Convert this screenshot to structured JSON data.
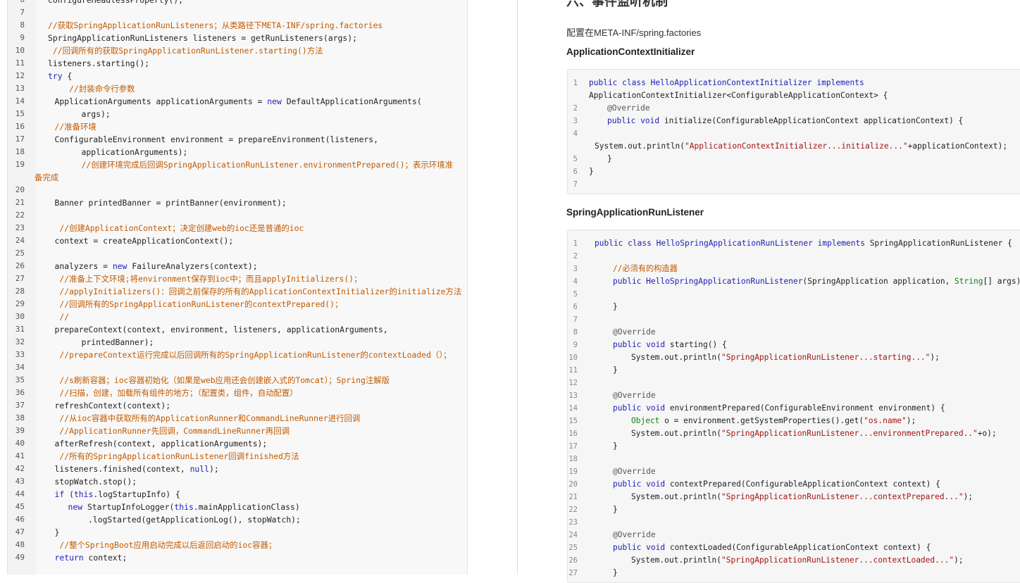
{
  "left_editor": {
    "lines": [
      {
        "n": "6",
        "t": "configureHeadlessProperty();",
        "c": "",
        "i": 2
      },
      {
        "n": "7",
        "t": "",
        "c": "",
        "i": 2
      },
      {
        "n": "8",
        "t": "//获取SpringApplicationRunListeners；从类路径下META-INF/spring.factories",
        "c": "cm",
        "i": 2
      },
      {
        "n": "9",
        "t": "SpringApplicationRunListeners listeners = getRunListeners(args);",
        "c": "",
        "i": 2
      },
      {
        "n": "10",
        "t": " //回调所有的获取SpringApplicationRunListener.starting()方法",
        "c": "cm",
        "i": 2
      },
      {
        "n": "11",
        "t": "listeners.starting();",
        "c": "",
        "i": 2
      },
      {
        "n": "12",
        "t": "try {",
        "c": "kw",
        "i": 2
      },
      {
        "n": "13",
        "t": "   //封装命令行参数",
        "c": "cm",
        "i": 3
      },
      {
        "n": "14",
        "t": "ApplicationArguments applicationArguments = new DefaultApplicationArguments(",
        "c": "",
        "i": 3
      },
      {
        "n": "15",
        "t": "args);",
        "c": "",
        "i": 7
      },
      {
        "n": "16",
        "t": "//准备环境",
        "c": "cm",
        "i": 3
      },
      {
        "n": "17",
        "t": "ConfigurableEnvironment environment = prepareEnvironment(listeners,",
        "c": "",
        "i": 3
      },
      {
        "n": "18",
        "t": "applicationArguments);",
        "c": "",
        "i": 7
      },
      {
        "n": "19",
        "t": "//创建环境完成后回调SpringApplicationRunListener.environmentPrepared()；表示环境准",
        "c": "cm",
        "i": 7
      },
      {
        "n": "",
        "t": "备完成",
        "c": "cm",
        "i": 0
      },
      {
        "n": "20",
        "t": "",
        "c": "",
        "i": 2
      },
      {
        "n": "21",
        "t": "Banner printedBanner = printBanner(environment);",
        "c": "",
        "i": 3
      },
      {
        "n": "22",
        "t": "",
        "c": "",
        "i": 2
      },
      {
        "n": "23",
        "t": " //创建ApplicationContext；决定创建web的ioc还是普通的ioc",
        "c": "cm",
        "i": 3
      },
      {
        "n": "24",
        "t": "context = createApplicationContext();",
        "c": "",
        "i": 3
      },
      {
        "n": "25",
        "t": "",
        "c": "",
        "i": 2
      },
      {
        "n": "26",
        "t": "analyzers = new FailureAnalyzers(context);",
        "c": "",
        "i": 3
      },
      {
        "n": "27",
        "t": " //准备上下文环境;将environment保存到ioc中；而且applyInitializers()；",
        "c": "cm",
        "i": 3
      },
      {
        "n": "28",
        "t": " //applyInitializers()：回调之前保存的所有的ApplicationContextInitializer的initialize方法",
        "c": "cm",
        "i": 3
      },
      {
        "n": "29",
        "t": " //回调所有的SpringApplicationRunListener的contextPrepared()；",
        "c": "cm",
        "i": 3
      },
      {
        "n": "30",
        "t": " //",
        "c": "cm",
        "i": 3
      },
      {
        "n": "31",
        "t": "prepareContext(context, environment, listeners, applicationArguments,",
        "c": "",
        "i": 3
      },
      {
        "n": "32",
        "t": "printedBanner);",
        "c": "",
        "i": 7
      },
      {
        "n": "33",
        "t": " //prepareContext运行完成以后回调所有的SpringApplicationRunListener的contextLoaded（）；",
        "c": "cm",
        "i": 3
      },
      {
        "n": "34",
        "t": "",
        "c": "",
        "i": 2
      },
      {
        "n": "35",
        "t": " //s刷新容器；ioc容器初始化（如果是web应用还会创建嵌入式的Tomcat）；Spring注解版",
        "c": "cm",
        "i": 3
      },
      {
        "n": "36",
        "t": " //扫描，创建，加载所有组件的地方；（配置类，组件，自动配置）",
        "c": "cm",
        "i": 3
      },
      {
        "n": "37",
        "t": "refreshContext(context);",
        "c": "",
        "i": 3
      },
      {
        "n": "38",
        "t": " //从ioc容器中获取所有的ApplicationRunner和CommandLineRunner进行回调",
        "c": "cm",
        "i": 3
      },
      {
        "n": "39",
        "t": " //ApplicationRunner先回调，CommandLineRunner再回调",
        "c": "cm",
        "i": 3
      },
      {
        "n": "40",
        "t": "afterRefresh(context, applicationArguments);",
        "c": "",
        "i": 3
      },
      {
        "n": "41",
        "t": " //所有的SpringApplicationRunListener回调finished方法",
        "c": "cm",
        "i": 3
      },
      {
        "n": "42",
        "t": "listeners.finished(context, null);",
        "c": "",
        "i": 3
      },
      {
        "n": "43",
        "t": "stopWatch.stop();",
        "c": "",
        "i": 3
      },
      {
        "n": "44",
        "t": "if (this.logStartupInfo) {",
        "c": "",
        "i": 3
      },
      {
        "n": "45",
        "t": "new StartupInfoLogger(this.mainApplicationClass)",
        "c": "",
        "i": 5
      },
      {
        "n": "46",
        "t": ".logStarted(getApplicationLog(), stopWatch);",
        "c": "",
        "i": 8
      },
      {
        "n": "47",
        "t": "}",
        "c": "",
        "i": 3
      },
      {
        "n": "48",
        "t": " //整个SpringBoot应用启动完成以后返回启动的ioc容器；",
        "c": "cm",
        "i": 3
      },
      {
        "n": "49",
        "t": "return context;",
        "c": "",
        "i": 3
      }
    ]
  },
  "right_doc": {
    "title": "六、事件监听机制",
    "para": "配置在META-INF/spring.factories",
    "section1_heading": "ApplicationContextInitializer",
    "section2_heading": "SpringApplicationRunListener",
    "block1": [
      {
        "n": "1",
        "t": "public class HelloApplicationContextInitializer implements",
        "i": 0
      },
      {
        "n": "",
        "t": "ApplicationContextInitializer<ConfigurableApplicationContext> {",
        "i": 0
      },
      {
        "n": "2",
        "t": "@Override",
        "i": 2
      },
      {
        "n": "3",
        "t": "public void initialize(ConfigurableApplicationContext applicationContext) {",
        "i": 2
      },
      {
        "n": "4",
        "t": "",
        "i": 0
      },
      {
        "n": "",
        "t": "System.out.println(\"ApplicationContextInitializer...initialize...\"+applicationContext);",
        "i": -1
      },
      {
        "n": "5",
        "t": "}",
        "i": 2
      },
      {
        "n": "6",
        "t": "}",
        "i": 0
      },
      {
        "n": "7",
        "t": "",
        "i": 0
      }
    ],
    "block2": [
      {
        "n": "1",
        "t": "public class HelloSpringApplicationRunListener implements SpringApplicationRunListener {",
        "i": 0
      },
      {
        "n": "2",
        "t": "",
        "i": 0
      },
      {
        "n": "3",
        "t": "//必须有的构造器",
        "i": 2
      },
      {
        "n": "4",
        "t": "public HelloSpringApplicationRunListener(SpringApplication application, String[] args){",
        "i": 2
      },
      {
        "n": "5",
        "t": "",
        "i": 0
      },
      {
        "n": "6",
        "t": "}",
        "i": 2
      },
      {
        "n": "7",
        "t": "",
        "i": 0
      },
      {
        "n": "8",
        "t": "@Override",
        "i": 2
      },
      {
        "n": "9",
        "t": "public void starting() {",
        "i": 2
      },
      {
        "n": "10",
        "t": "System.out.println(\"SpringApplicationRunListener...starting...\");",
        "i": 4
      },
      {
        "n": "11",
        "t": "}",
        "i": 2
      },
      {
        "n": "12",
        "t": "",
        "i": 0
      },
      {
        "n": "13",
        "t": "@Override",
        "i": 2
      },
      {
        "n": "14",
        "t": "public void environmentPrepared(ConfigurableEnvironment environment) {",
        "i": 2
      },
      {
        "n": "15",
        "t": "Object o = environment.getSystemProperties().get(\"os.name\");",
        "i": 4
      },
      {
        "n": "16",
        "t": "System.out.println(\"SpringApplicationRunListener...environmentPrepared..\"+o);",
        "i": 4
      },
      {
        "n": "17",
        "t": "}",
        "i": 2
      },
      {
        "n": "18",
        "t": "",
        "i": 0
      },
      {
        "n": "19",
        "t": "@Override",
        "i": 2
      },
      {
        "n": "20",
        "t": "public void contextPrepared(ConfigurableApplicationContext context) {",
        "i": 2
      },
      {
        "n": "21",
        "t": "System.out.println(\"SpringApplicationRunListener...contextPrepared...\");",
        "i": 4
      },
      {
        "n": "22",
        "t": "}",
        "i": 2
      },
      {
        "n": "23",
        "t": "",
        "i": 0
      },
      {
        "n": "24",
        "t": "@Override",
        "i": 2
      },
      {
        "n": "25",
        "t": "public void contextLoaded(ConfigurableApplicationContext context) {",
        "i": 2
      },
      {
        "n": "26",
        "t": "System.out.println(\"SpringApplicationRunListener...contextLoaded...\");",
        "i": 4
      },
      {
        "n": "27",
        "t": "}",
        "i": 2
      }
    ]
  }
}
